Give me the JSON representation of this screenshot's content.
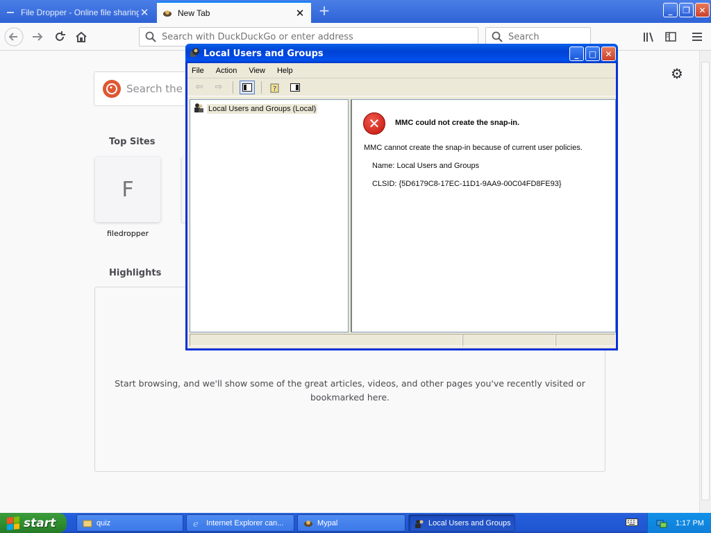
{
  "browser": {
    "tabs": [
      {
        "label": "File Dropper - Online file sharing",
        "active": false
      },
      {
        "label": "New Tab",
        "active": true
      }
    ],
    "url_placeholder": "Search with DuckDuckGo or enter address",
    "search_placeholder": "Search"
  },
  "newtab": {
    "search_placeholder": "Search the W",
    "top_sites_title": "Top Sites",
    "top_sites": [
      {
        "letter": "F",
        "label": "filedropper"
      }
    ],
    "highlights_title": "Highlights",
    "highlights_empty": "Start browsing, and we'll show some of the great articles, videos, and other pages you've recently visited or bookmarked here."
  },
  "mmc": {
    "title": "Local Users and Groups",
    "menu": [
      "File",
      "Action",
      "View",
      "Help"
    ],
    "tree_item": "Local Users and Groups (Local)",
    "error": {
      "heading": "MMC could not create the snap-in.",
      "message": "MMC cannot create the snap-in because of current user policies.",
      "name_line": "Name: Local Users and Groups",
      "clsid_line": "CLSID: {5D6179C8-17EC-11D1-9AA9-00C04FD8FE93}"
    }
  },
  "taskbar": {
    "start_label": "start",
    "tasks": [
      {
        "label": "quiz",
        "icon": "folder-icon",
        "active": false
      },
      {
        "label": "Internet Explorer can...",
        "icon": "ie-icon",
        "active": false
      },
      {
        "label": "Mypal",
        "icon": "mypal-icon",
        "active": false
      },
      {
        "label": "Local Users and Groups",
        "icon": "mmc-icon",
        "active": true
      }
    ],
    "clock": "1:17 PM"
  },
  "colors": {
    "accent": "#0a84ff",
    "xp_title_blue": "#0042d4",
    "error_red": "#c1140b",
    "start_green": "#2f8f2f"
  }
}
